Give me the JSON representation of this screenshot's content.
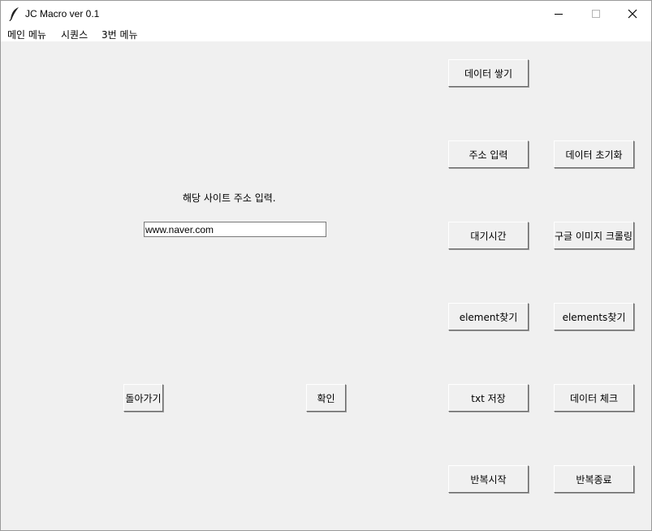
{
  "window": {
    "title": "JC Macro ver 0.1",
    "controls": {
      "minimize": "—",
      "maximize": "☐",
      "close": "✕"
    }
  },
  "menubar": {
    "items": [
      {
        "label": "메인 메뉴"
      },
      {
        "label": "시퀀스"
      },
      {
        "label": "3번 메뉴"
      }
    ]
  },
  "main": {
    "prompt_label": "해당 사이트 주소 입력.",
    "url_input": {
      "value": "www.naver.com",
      "placeholder": ""
    },
    "back_button": "돌아가기",
    "confirm_button": "확인"
  },
  "right_panel": {
    "col1": [
      "데이터 쌓기",
      "주소 입력",
      "대기시간",
      "element찾기",
      "txt 저장",
      "반복시작"
    ],
    "col2": [
      "데이터 초기화",
      "구글 이미지 크롤링",
      "elements찾기",
      "데이터 체크",
      "반복종료"
    ]
  }
}
